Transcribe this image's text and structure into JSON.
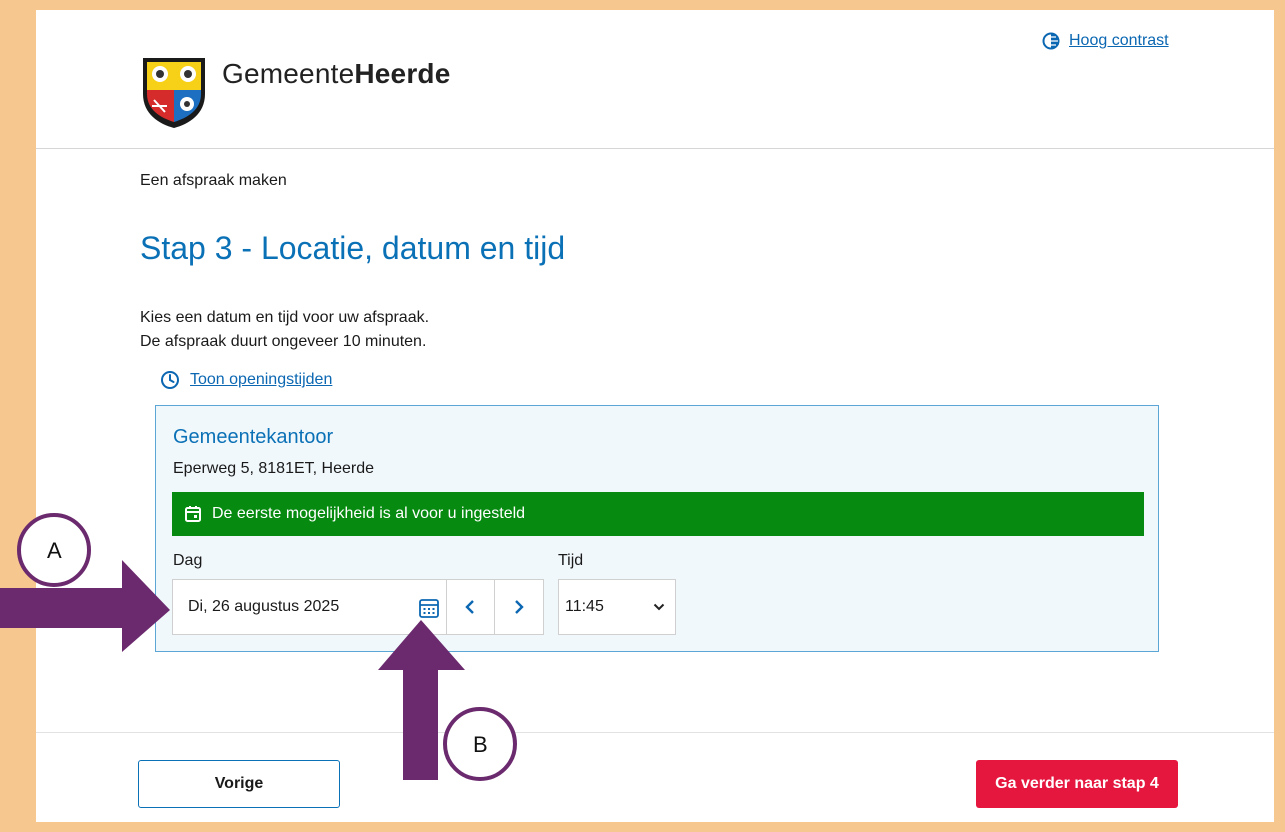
{
  "header": {
    "brand_prefix": "Gemeente",
    "brand_name": "Heerde",
    "contrast_link": "Hoog contrast"
  },
  "breadcrumb": "Een afspraak maken",
  "page_title": "Stap 3 - Locatie, datum en tijd",
  "intro": {
    "line1": "Kies een datum en tijd voor uw afspraak.",
    "line2": "De afspraak duurt ongeveer 10 minuten."
  },
  "opening_hours_link": "Toon openingstijden",
  "location": {
    "name": "Gemeentekantoor",
    "address": "Eperweg 5, 8181ET, Heerde",
    "notice": "De eerste mogelijkheid is al voor u ingesteld",
    "day_label": "Dag",
    "time_label": "Tijd",
    "date_value": "Di, 26 augustus 2025",
    "time_value": "11:45"
  },
  "footer": {
    "prev_label": "Vorige",
    "next_label": "Ga verder naar stap 4"
  },
  "annotations": {
    "marker_a": "A",
    "marker_b": "B"
  },
  "colors": {
    "accent_blue": "#0b71b6",
    "notice_green": "#068a10",
    "cta_red": "#e5173f",
    "arrow_purple": "#6b2a6e",
    "frame_orange": "#f6c88f"
  },
  "icons": [
    "coat-of-arms-logo",
    "contrast-icon",
    "clock-icon",
    "calendar-icon",
    "calendar-grid-icon",
    "chevron-left-icon",
    "chevron-right-icon",
    "chevron-down-icon"
  ]
}
